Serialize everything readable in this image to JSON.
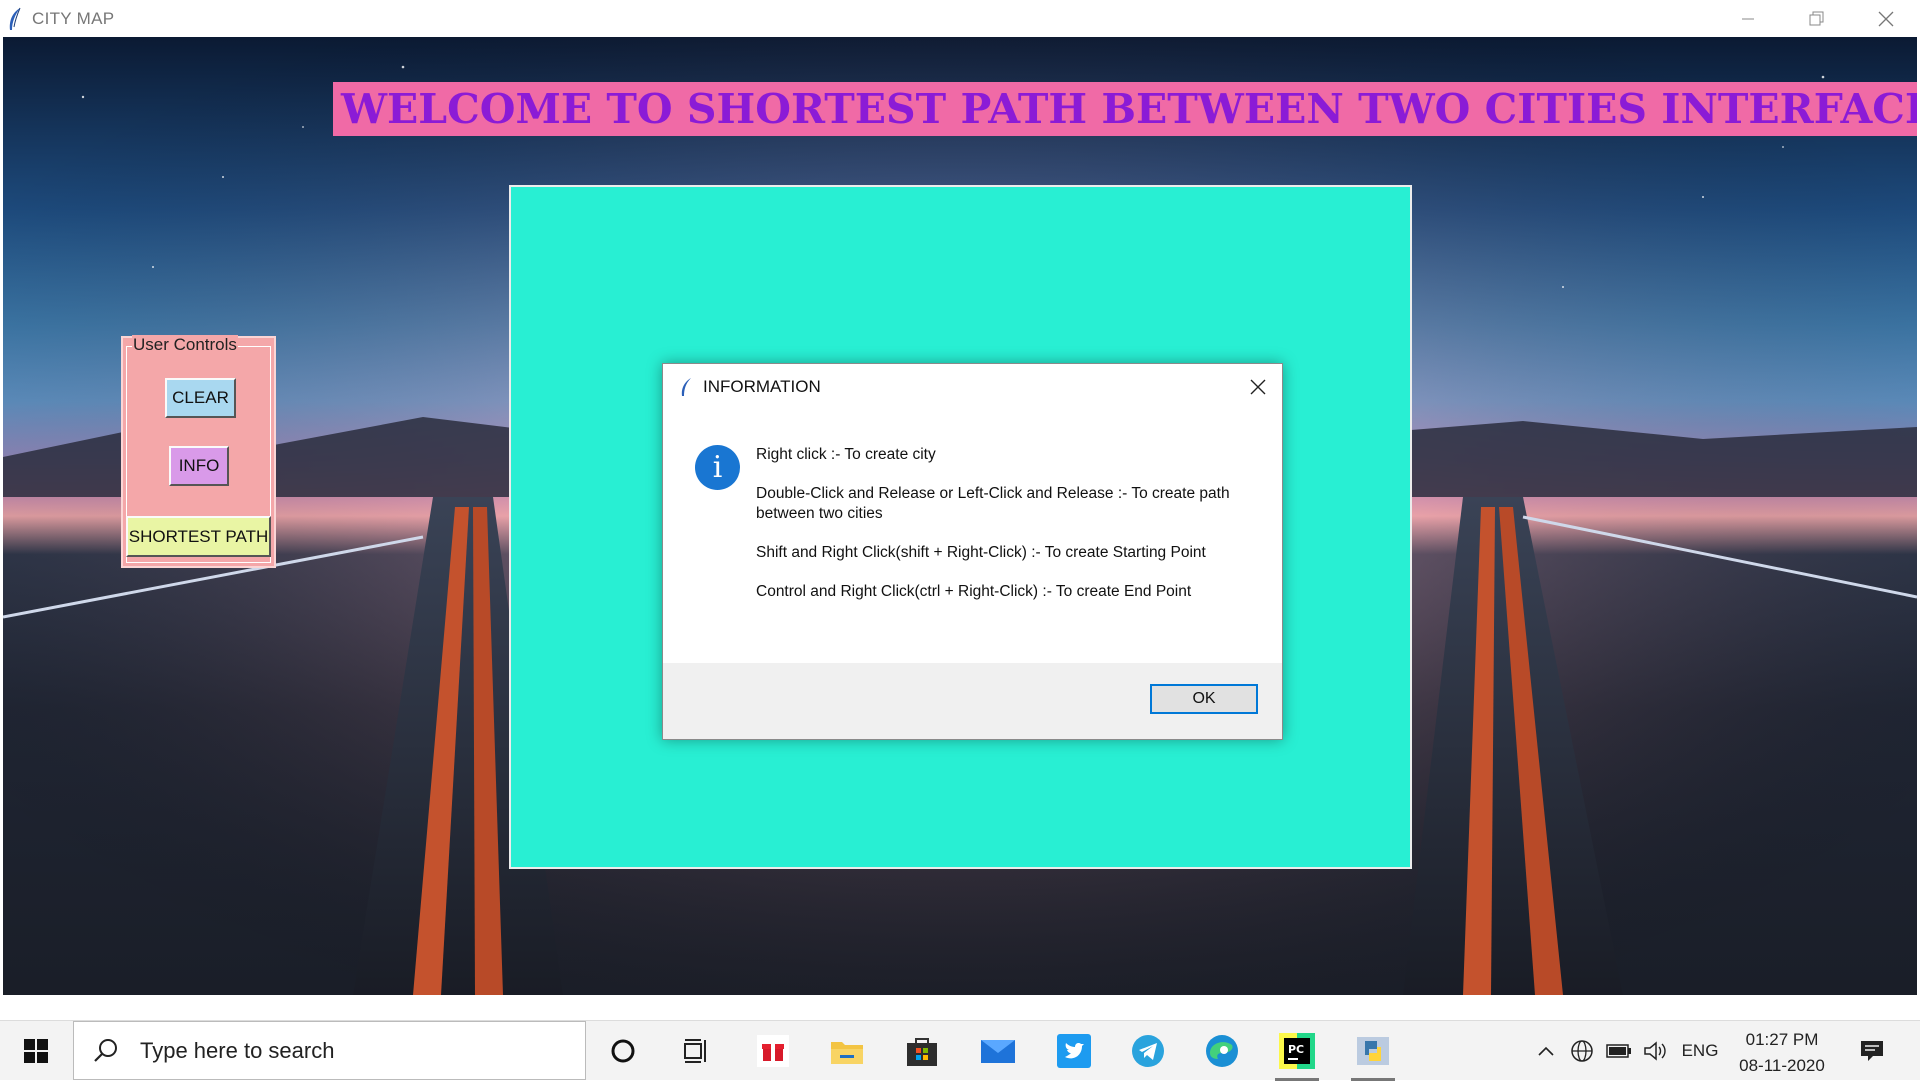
{
  "window": {
    "title": "CITY MAP",
    "controls": [
      "minimize-icon",
      "restore-icon",
      "close-icon"
    ]
  },
  "header": {
    "welcome_text": "WELCOME TO SHORTEST PATH BETWEEN TWO CITIES INTERFACE"
  },
  "controls_panel": {
    "legend": "User Controls",
    "clear_label": "CLEAR",
    "info_label": "INFO",
    "shortest_path_label": "SHORTEST PATH"
  },
  "dialog": {
    "title": "INFORMATION",
    "lines": [
      "Right click :- To create city",
      "Double-Click and Release or Left-Click and Release :- To create path between two cities",
      "Shift and Right Click(shift + Right-Click) :- To create Starting Point",
      "Control and Right Click(ctrl + Right-Click) :- To create End Point"
    ],
    "ok_label": "OK"
  },
  "taskbar": {
    "search_placeholder": "Type here to search",
    "apps": [
      "cortana-icon",
      "task-view-icon",
      "gift-icon",
      "file-explorer-icon",
      "store-icon",
      "mail-icon",
      "twitter-icon",
      "telegram-icon",
      "edge-icon",
      "pycharm-icon",
      "python-icon"
    ],
    "tray": {
      "language": "ENG",
      "time": "01:27 PM",
      "date": "08-11-2020"
    }
  },
  "colors": {
    "welcome_bg": "#f06aa6",
    "welcome_text": "#8b1bd6",
    "map_canvas": "#28efd3",
    "controls_bg": "#f4a7a9",
    "clear_btn": "#a9d8f0",
    "info_btn": "#d99ae9",
    "shortest_btn": "#e9f5a4",
    "info_icon": "#1976d2",
    "ok_border": "#0078d7"
  }
}
